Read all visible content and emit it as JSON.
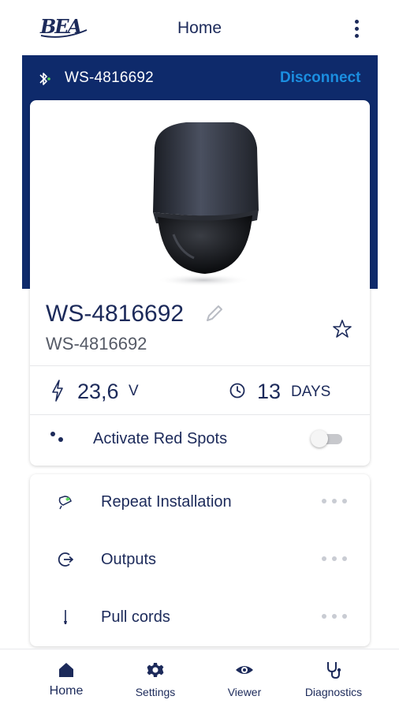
{
  "appbar": {
    "title": "Home",
    "logo_text": "BEA"
  },
  "connection": {
    "device_id": "WS-4816692",
    "disconnect_label": "Disconnect"
  },
  "device": {
    "name": "WS-4816692",
    "subtitle": "WS-4816692",
    "voltage_value": "23,6",
    "voltage_unit": "V",
    "days_value": "13",
    "days_unit": "DAYS",
    "red_spots_label": "Activate Red Spots",
    "red_spots_enabled": false
  },
  "actions": [
    {
      "label": "Repeat Installation",
      "icon": "installation-icon"
    },
    {
      "label": "Outputs",
      "icon": "outputs-icon"
    },
    {
      "label": "Pull cords",
      "icon": "pull-cord-icon"
    }
  ],
  "bottom_nav": [
    {
      "label": "Home",
      "icon": "home-icon",
      "active": true
    },
    {
      "label": "Settings",
      "icon": "gear-icon",
      "active": false
    },
    {
      "label": "Viewer",
      "icon": "eye-icon",
      "active": false
    },
    {
      "label": "Diagnostics",
      "icon": "stethoscope-icon",
      "active": false
    }
  ],
  "colors": {
    "navy": "#0e2a6b",
    "text": "#1c2a5a",
    "accent_blue": "#1b8ee0",
    "bluetooth_green": "#5bd65b"
  }
}
